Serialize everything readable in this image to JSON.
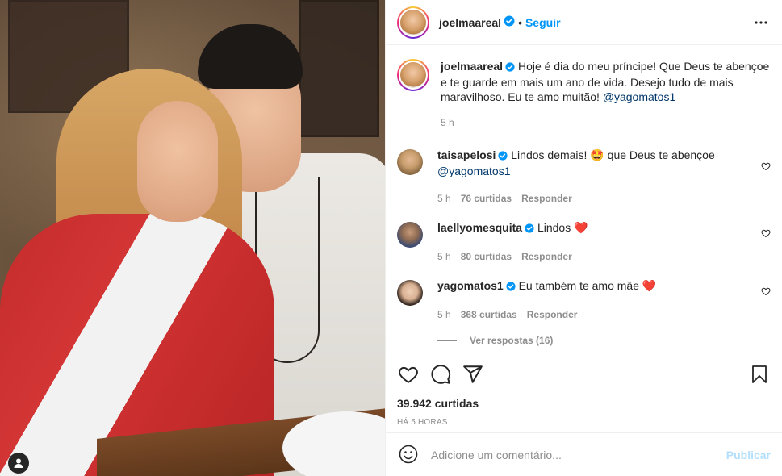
{
  "post": {
    "username": "joelmaareal",
    "follow_label": "Seguir",
    "caption_text": "Hoje é dia do meu príncipe! Que Deus te abençoe e te guarde em mais um ano de vida. Desejo tudo de mais maravilhoso. Eu te amo muitão!",
    "caption_mention": "@yagomatos1",
    "caption_time": "5 h"
  },
  "comments": [
    {
      "username": "taisapelosi",
      "text": "Lindos demais!",
      "emoji": "🤩",
      "text2": "que Deus te abençoe",
      "mention": "@yagomatos1",
      "time": "5 h",
      "likes": "76 curtidas",
      "reply": "Responder"
    },
    {
      "username": "laellyomesquita",
      "text": "Lindos",
      "emoji": "❤️",
      "time": "5 h",
      "likes": "80 curtidas",
      "reply": "Responder"
    },
    {
      "username": "yagomatos1",
      "text": "Eu também te amo mãe",
      "emoji": "❤️",
      "time": "5 h",
      "likes": "368 curtidas",
      "reply": "Responder"
    }
  ],
  "view_replies": "Ver respostas (16)",
  "likes_count": "39.942 curtidas",
  "time_ago": "HÁ 5 HORAS",
  "add_comment": {
    "placeholder": "Adicione um comentário...",
    "publish": "Publicar"
  },
  "colors": {
    "accent": "#0095f6",
    "text": "#262626",
    "muted": "#8e8e8e",
    "mention": "#00376b",
    "publish_disabled": "#b2dffc"
  },
  "icons": [
    "verified-badge-icon",
    "more-options-icon",
    "heart-icon",
    "comment-icon",
    "share-icon",
    "bookmark-icon",
    "emoji-icon",
    "user-tag-icon"
  ]
}
